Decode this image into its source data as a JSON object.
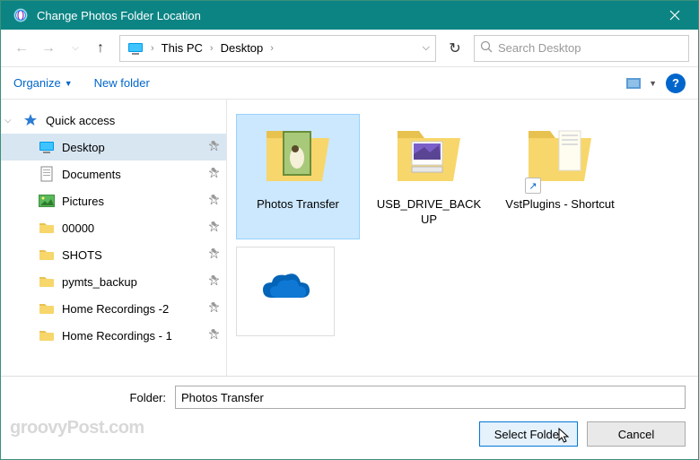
{
  "window": {
    "title": "Change Photos Folder Location"
  },
  "nav": {
    "breadcrumb": [
      "This PC",
      "Desktop"
    ],
    "search_placeholder": "Search Desktop"
  },
  "toolbar": {
    "organize": "Organize",
    "new_folder": "New folder"
  },
  "sidebar": {
    "quick_access": "Quick access",
    "items": [
      {
        "label": "Desktop",
        "icon": "monitor",
        "selected": true,
        "pinned": true
      },
      {
        "label": "Documents",
        "icon": "doc",
        "selected": false,
        "pinned": true
      },
      {
        "label": "Pictures",
        "icon": "pictures",
        "selected": false,
        "pinned": true
      },
      {
        "label": "00000",
        "icon": "folder",
        "selected": false,
        "pinned": true
      },
      {
        "label": "SHOTS",
        "icon": "folder",
        "selected": false,
        "pinned": true
      },
      {
        "label": "pymts_backup",
        "icon": "folder",
        "selected": false,
        "pinned": true
      },
      {
        "label": "Home Recordings -2",
        "icon": "folder",
        "selected": false,
        "pinned": true
      },
      {
        "label": "Home Recordings - 1",
        "icon": "folder",
        "selected": false,
        "pinned": true
      }
    ]
  },
  "content": {
    "items": [
      {
        "label": "Photos Transfer",
        "kind": "folder-photo",
        "selected": true
      },
      {
        "label": "USB_DRIVE_BACKUP",
        "kind": "folder-usb",
        "selected": false
      },
      {
        "label": "VstPlugins - Shortcut",
        "kind": "folder-shortcut",
        "selected": false
      },
      {
        "label": "",
        "kind": "onedrive",
        "selected": false
      }
    ]
  },
  "footer": {
    "folder_label": "Folder:",
    "folder_value": "Photos Transfer",
    "select_button": "Select Folder",
    "cancel_button": "Cancel",
    "watermark": "groovyPost.com"
  }
}
